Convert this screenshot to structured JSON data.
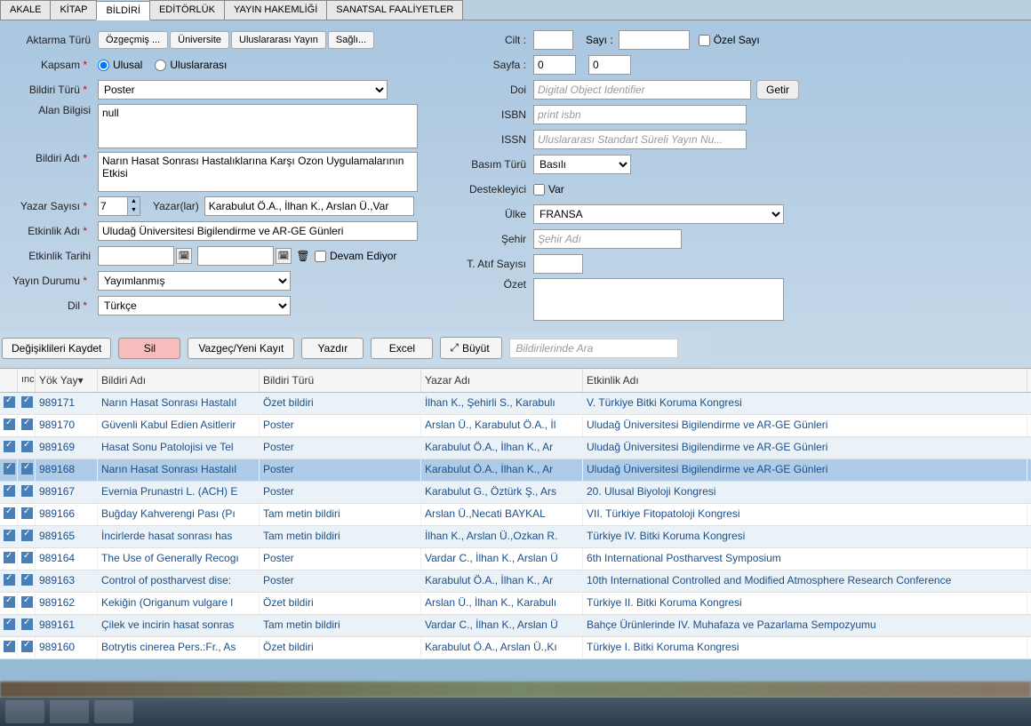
{
  "tabs": [
    "AKALE",
    "KİTAP",
    "BİLDİRİ",
    "EDİTÖRLÜK",
    "YAYIN HAKEMLİĞİ",
    "SANATSAL FAALİYETLER"
  ],
  "active_tab": 2,
  "form": {
    "aktarma_turu_lbl": "Aktarma Türü",
    "aktarma_buttons": [
      "Özgeçmiş ...",
      "Üniversite",
      "Uluslararası Yayın",
      "Sağlı..."
    ],
    "kapsam_lbl": "Kapsam",
    "kapsam_opts": [
      "Ulusal",
      "Uluslararası"
    ],
    "bildiri_turu_lbl": "Bildiri Türü",
    "bildiri_turu_val": "Poster",
    "alan_bilgisi_lbl": "Alan Bilgisi",
    "alan_bilgisi_val": "null",
    "bildiri_adi_lbl": "Bildiri Adı",
    "bildiri_adi_val": "Narın Hasat Sonrası Hastalıklarına Karşı Ozon Uygulamalarının Etkisi",
    "yazar_sayisi_lbl": "Yazar Sayısı",
    "yazar_sayisi_val": "7",
    "yazarlar_lbl": "Yazar(lar)",
    "yazarlar_val": "Karabulut Ö.A., İlhan K., Arslan Ü.,Var",
    "etkinlik_adi_lbl": "Etkinlik Adı",
    "etkinlik_adi_val": "Uludağ Üniversitesi Bigilendirme ve AR-GE Günleri",
    "etkinlik_tarihi_lbl": "Etkinlik Tarihi",
    "devam_ediyor_lbl": "Devam Ediyor",
    "yayin_durumu_lbl": "Yayın Durumu",
    "yayin_durumu_val": "Yayımlanmış",
    "dil_lbl": "Dil",
    "dil_val": "Türkçe",
    "cilt_lbl": "Cilt :",
    "sayi_lbl": "Sayı :",
    "ozel_sayi_lbl": "Özel Sayı",
    "sayfa_lbl": "Sayfa :",
    "sayfa1": "0",
    "sayfa2": "0",
    "doi_lbl": "Doi",
    "doi_ph": "Digital Object Identifier",
    "getir_lbl": "Getir",
    "isbn_lbl": "ISBN",
    "isbn_ph": "print isbn",
    "issn_lbl": "ISSN",
    "issn_ph": "Uluslararası Standart Süreli Yayın Nu...",
    "basim_turu_lbl": "Basım Türü",
    "basim_turu_val": "Basılı",
    "destekleyici_lbl": "Destekleyici",
    "var_lbl": "Var",
    "ulke_lbl": "Ülke",
    "ulke_val": "FRANSA",
    "sehir_lbl": "Şehir",
    "sehir_ph": "Şehir Adı",
    "atif_lbl": "T. Atıf Sayısı",
    "ozet_lbl": "Özet"
  },
  "actions": {
    "kaydet": "Değişiklileri Kaydet",
    "sil": "Sil",
    "vazgec": "Vazgeç/Yeni Kayıt",
    "yazdir": "Yazdır",
    "excel": "Excel",
    "buyut": "Büyüt",
    "search_ph": "Bildirilerinde Ara"
  },
  "grid": {
    "headers": [
      "ıncelle",
      "Yök Yay▾",
      "Bildiri Adı",
      "Bildiri Türü",
      "Yazar Adı",
      "Etkinlik Adı"
    ],
    "rows": [
      {
        "id": "989171",
        "adi": "Narın Hasat Sonrası Hastalıl",
        "turu": "Özet bildiri",
        "yazar": "İlhan K., Şehirli S., Karabulı",
        "etk": "V. Türkiye Bitki Koruma Kongresi"
      },
      {
        "id": "989170",
        "adi": "Güvenli Kabul Edien Asitlerir",
        "turu": "Poster",
        "yazar": "Arslan Ü., Karabulut Ö.A., İl",
        "etk": "Uludağ Üniversitesi Bigilendirme ve AR-GE Günleri"
      },
      {
        "id": "989169",
        "adi": "Hasat Sonu Patolojisi ve Tel",
        "turu": "Poster",
        "yazar": "Karabulut Ö.A., İlhan K., Ar",
        "etk": "Uludağ Üniversitesi Bigilendirme ve AR-GE Günleri"
      },
      {
        "id": "989168",
        "adi": "Narın Hasat Sonrası Hastalıl",
        "turu": "Poster",
        "yazar": "Karabulut Ö.A., İlhan K., Ar",
        "etk": "Uludağ Üniversitesi Bigilendirme ve AR-GE Günleri",
        "selected": true
      },
      {
        "id": "989167",
        "adi": "Evernia Prunastri L. (ACH) E",
        "turu": "Poster",
        "yazar": "Karabulut G., Öztürk Ş., Ars",
        "etk": "20. Ulusal Biyoloji Kongresi"
      },
      {
        "id": "989166",
        "adi": "Buğday Kahverengi Pası (Pı",
        "turu": "Tam metin bildiri",
        "yazar": "Arslan Ü.,Necati BAYKAL",
        "etk": "VII. Türkiye Fitopatoloji Kongresi"
      },
      {
        "id": "989165",
        "adi": "İncirlerde hasat sonrası has",
        "turu": "Tam metin bildiri",
        "yazar": "İlhan K., Arslan Ü.,Ozkan R.",
        "etk": "Türkiye IV. Bitki  Koruma Kongresi"
      },
      {
        "id": "989164",
        "adi": "The Use of Generally Recogı",
        "turu": "Poster",
        "yazar": "Vardar C., İlhan K., Arslan Ü",
        "etk": "6th International Postharvest Symposium"
      },
      {
        "id": "989163",
        "adi": "Control of postharvest dise:",
        "turu": "Poster",
        "yazar": "Karabulut Ö.A., İlhan K., Ar",
        "etk": "10th International Controlled and Modified Atmosphere Research Conference"
      },
      {
        "id": "989162",
        "adi": "Kekiğin (Origanum vulgare l",
        "turu": "Özet bildiri",
        "yazar": "Arslan Ü., İlhan K., Karabulı",
        "etk": "Türkiye II. Bitki Koruma Kongresi"
      },
      {
        "id": "989161",
        "adi": "Çilek ve incirin hasat sonras",
        "turu": "Tam metin bildiri",
        "yazar": "Vardar C., İlhan K., Arslan Ü",
        "etk": "Bahçe Ürünlerinde IV. Muhafaza ve Pazarlama Sempozyumu"
      },
      {
        "id": "989160",
        "adi": "Botrytis cinerea Pers.:Fr., As",
        "turu": "Özet bildiri",
        "yazar": "Karabulut Ö.A., Arslan Ü.,Kı",
        "etk": "Türkiye I. Bitki Koruma Kongresi"
      }
    ]
  }
}
